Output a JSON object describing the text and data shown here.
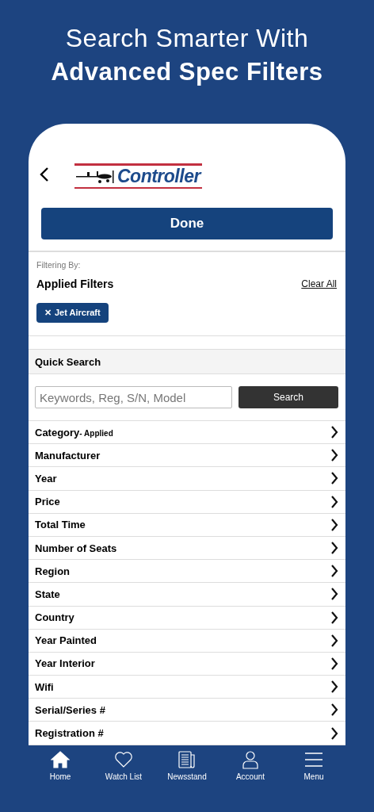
{
  "headline": {
    "line_1": "Search Smarter With",
    "line_2": "Advanced Spec Filters"
  },
  "header": {
    "logo_text": "Controller"
  },
  "done_button": "Done",
  "filters": {
    "caption": "Filtering By:",
    "title": "Applied Filters",
    "clear_link": "Clear All",
    "chips": [
      {
        "icon": "✕",
        "label": "Jet Aircraft"
      }
    ]
  },
  "quick_search": {
    "title": "Quick Search",
    "placeholder": "Keywords, Reg, S/N, Model",
    "button": "Search"
  },
  "filter_rows": [
    {
      "label": "Category",
      "note": "- Applied"
    },
    {
      "label": "Manufacturer"
    },
    {
      "label": "Year"
    },
    {
      "label": "Price"
    },
    {
      "label": "Total Time"
    },
    {
      "label": "Number of Seats"
    },
    {
      "label": "Region"
    },
    {
      "label": "State"
    },
    {
      "label": "Country"
    },
    {
      "label": "Year Painted"
    },
    {
      "label": "Year Interior"
    },
    {
      "label": "Wifi"
    },
    {
      "label": "Serial/Series #"
    },
    {
      "label": "Registration #"
    }
  ],
  "tab_bar": [
    {
      "kind": "home",
      "label": "Home",
      "selected": true
    },
    {
      "kind": "heart",
      "label": "Watch List",
      "selected": false
    },
    {
      "kind": "news",
      "label": "Newsstand",
      "selected": false
    },
    {
      "kind": "person",
      "label": "Account",
      "selected": false
    },
    {
      "kind": "menu",
      "label": "Menu",
      "selected": false
    }
  ]
}
